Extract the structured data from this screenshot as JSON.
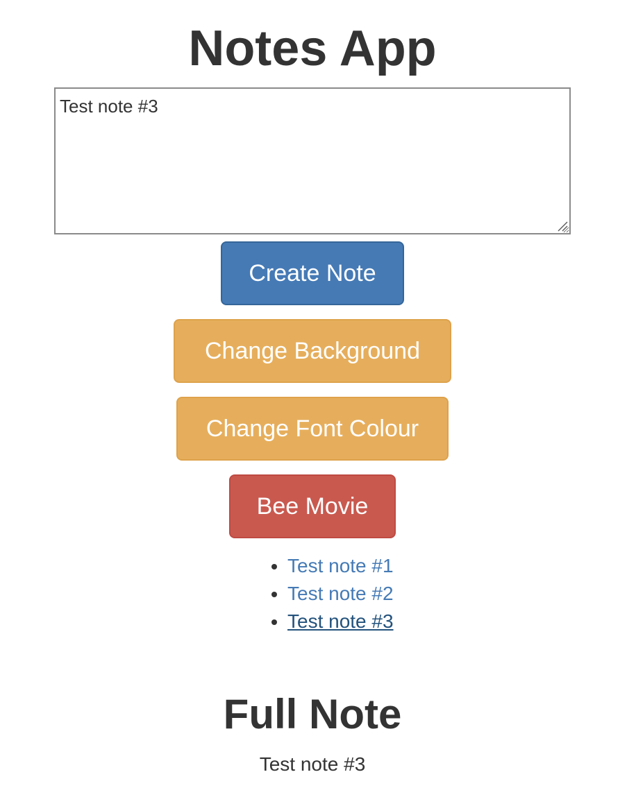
{
  "app": {
    "title": "Notes App"
  },
  "editor": {
    "value": "Test note #3"
  },
  "buttons": {
    "create": "Create Note",
    "change_background": "Change Background",
    "change_font_colour": "Change Font Colour",
    "bee_movie": "Bee Movie"
  },
  "notes": [
    {
      "label": "Test note #1"
    },
    {
      "label": "Test note #2"
    },
    {
      "label": "Test note #3"
    }
  ],
  "full_note": {
    "heading": "Full Note",
    "text": "Test note #3"
  },
  "colors": {
    "primary": "#457ab5",
    "warning": "#e6ae5c",
    "danger": "#c9594f",
    "link": "#457ab5",
    "link_active": "#23527c",
    "text": "#333333"
  },
  "icons": {
    "resize_grip": "resize-grip-icon"
  }
}
